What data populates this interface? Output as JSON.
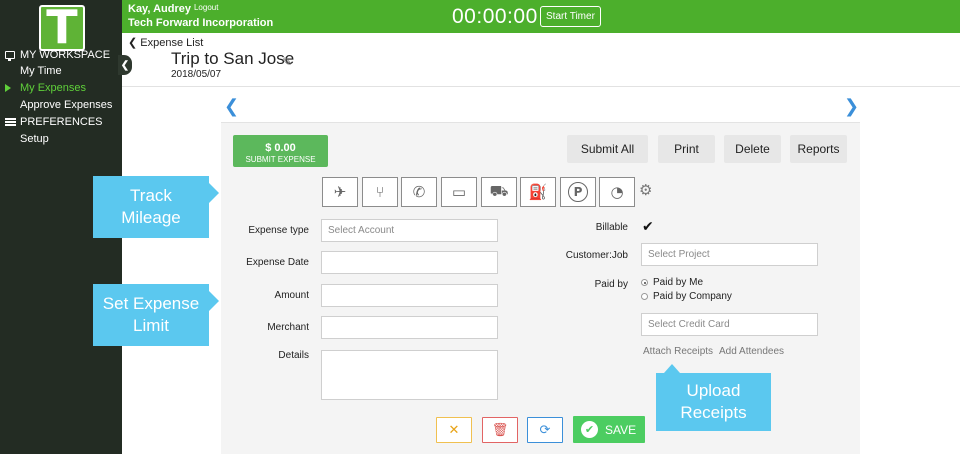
{
  "sidebar": {
    "logo_letter": "T",
    "workspace_label": "MY WORKSPACE",
    "items": [
      {
        "label": "My Time"
      },
      {
        "label": "My Expenses"
      },
      {
        "label": "Approve Expenses"
      }
    ],
    "preferences_label": "PREFERENCES",
    "setup_label": "Setup",
    "active_color": "#5fd03a"
  },
  "topbar": {
    "user_name": "Kay, Audrey",
    "logout_label": "Logout",
    "company": "Tech Forward Incorporation",
    "timer": "00:00:00",
    "start_timer_label": "Start Timer",
    "bg_color": "#4caf2c"
  },
  "header": {
    "breadcrumb": "Expense List",
    "trip_title": "Trip to San Jose",
    "trip_date": "2018/05/07"
  },
  "toolbar": {
    "submit_amount": "$ 0.00",
    "submit_label": "SUBMIT EXPENSE",
    "submit_all_label": "Submit All",
    "print_label": "Print",
    "delete_label": "Delete",
    "reports_label": "Reports"
  },
  "categories": [
    {
      "icon": "airplane-icon",
      "glyph": "✈"
    },
    {
      "icon": "fork-knife-icon",
      "glyph": "🍴"
    },
    {
      "icon": "phone-icon",
      "glyph": "✆"
    },
    {
      "icon": "hotel-bed-icon",
      "glyph": "🛏"
    },
    {
      "icon": "car-icon",
      "glyph": "🚗"
    },
    {
      "icon": "fuel-pump-icon",
      "glyph": "⛽"
    },
    {
      "icon": "parking-icon",
      "glyph": "P"
    },
    {
      "icon": "speedometer-icon",
      "glyph": "◔"
    }
  ],
  "form": {
    "expense_type_label": "Expense type",
    "expense_type_placeholder": "Select Account",
    "expense_date_label": "Expense Date",
    "expense_date_value": "",
    "amount_label": "Amount",
    "amount_value": "",
    "merchant_label": "Merchant",
    "merchant_value": "",
    "details_label": "Details",
    "details_value": "",
    "billable_label": "Billable",
    "billable_checked": true,
    "customer_job_label": "Customer:Job",
    "customer_job_placeholder": "Select Project",
    "paid_by_label": "Paid by",
    "paid_by_options": [
      "Paid by Me",
      "Paid by Company"
    ],
    "paid_by_selected": "Paid by Me",
    "credit_card_placeholder": "Select Credit Card",
    "attach_receipts_label": "Attach Receipts",
    "add_attendees_label": "Add Attendees"
  },
  "actions": {
    "save_label": "SAVE",
    "save_color": "#4ccd61"
  },
  "callouts": {
    "track_mileage": "Track\nMileage",
    "set_expense_limit": "Set Expense\nLimit",
    "upload_receipts": "Upload\nReceipts",
    "color": "#5bc8ef"
  }
}
